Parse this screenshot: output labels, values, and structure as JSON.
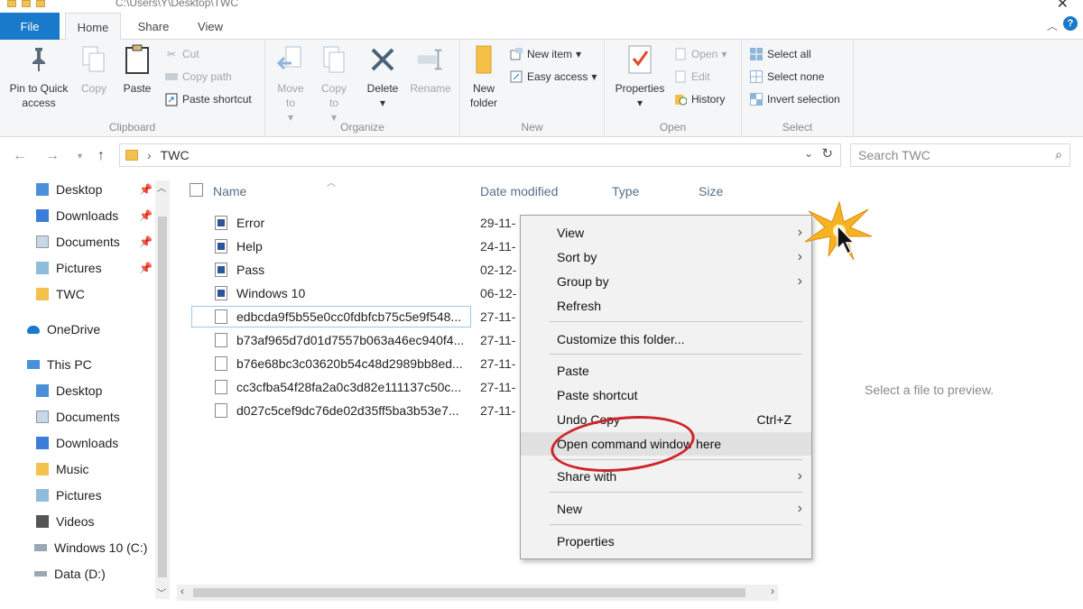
{
  "window": {
    "path": "C:\\Users\\Y\\Desktop\\TWC"
  },
  "tabs": [
    "File",
    "Home",
    "Share",
    "View"
  ],
  "ribbon": {
    "clipboard": {
      "label": "Clipboard",
      "pin": "Pin to Quick access",
      "copy": "Copy",
      "paste": "Paste",
      "cut": "Cut",
      "copy_path": "Copy path",
      "paste_shortcut": "Paste shortcut"
    },
    "organize": {
      "label": "Organize",
      "move_to": "Move to",
      "copy_to": "Copy to",
      "delete": "Delete",
      "rename": "Rename"
    },
    "new": {
      "label": "New",
      "new_folder": "New folder",
      "new_item": "New item",
      "easy_access": "Easy access"
    },
    "open": {
      "label": "Open",
      "properties": "Properties",
      "open": "Open",
      "edit": "Edit",
      "history": "History"
    },
    "select": {
      "label": "Select",
      "select_all": "Select all",
      "select_none": "Select none",
      "invert": "Invert selection"
    }
  },
  "address": {
    "current": "TWC",
    "search_placeholder": "Search TWC"
  },
  "nav": {
    "quick": [
      {
        "label": "Desktop",
        "pinned": true
      },
      {
        "label": "Downloads",
        "pinned": true
      },
      {
        "label": "Documents",
        "pinned": true
      },
      {
        "label": "Pictures",
        "pinned": true
      },
      {
        "label": "TWC",
        "pinned": false
      }
    ],
    "onedrive": "OneDrive",
    "thispc": "This PC",
    "pc_items": [
      "Desktop",
      "Documents",
      "Downloads",
      "Music",
      "Pictures",
      "Videos",
      "Windows 10 (C:)",
      "Data (D:)"
    ]
  },
  "columns": {
    "name": "Name",
    "date": "Date modified",
    "type": "Type",
    "size": "Size"
  },
  "files": [
    {
      "name": "Error",
      "date": "29-11-",
      "kind": "doc"
    },
    {
      "name": "Help",
      "date": "24-11-",
      "kind": "doc"
    },
    {
      "name": "Pass",
      "date": "02-12-",
      "kind": "doc"
    },
    {
      "name": "Windows 10",
      "date": "06-12-",
      "kind": "doc"
    },
    {
      "name": "edbcda9f5b55e0cc0fdbfcb75c5e9f548...",
      "date": "27-11-",
      "kind": "file"
    },
    {
      "name": "b73af965d7d01d7557b063a46ec940f4...",
      "date": "27-11-",
      "kind": "file"
    },
    {
      "name": "b76e68bc3c03620b54c48d2989bb8ed...",
      "date": "27-11-",
      "kind": "file"
    },
    {
      "name": "cc3cfba54f28fa2a0c3d82e111137c50c...",
      "date": "27-11-",
      "kind": "file"
    },
    {
      "name": "d027c5cef9dc76de02d35ff5ba3b53e7...",
      "date": "27-11-",
      "kind": "file"
    }
  ],
  "preview_text": "Select a file to preview.",
  "context_menu": {
    "view": "View",
    "sort_by": "Sort by",
    "group_by": "Group by",
    "refresh": "Refresh",
    "customize": "Customize this folder...",
    "paste": "Paste",
    "paste_shortcut": "Paste shortcut",
    "undo_copy": "Undo Copy",
    "undo_shortcut": "Ctrl+Z",
    "open_cmd": "Open command window here",
    "share_with": "Share with",
    "new": "New",
    "properties": "Properties"
  },
  "colors": {
    "accent": "#1979ca",
    "folder": "#f2c14e",
    "highlight_ring": "#d0242b",
    "burst": "#f5b322"
  }
}
